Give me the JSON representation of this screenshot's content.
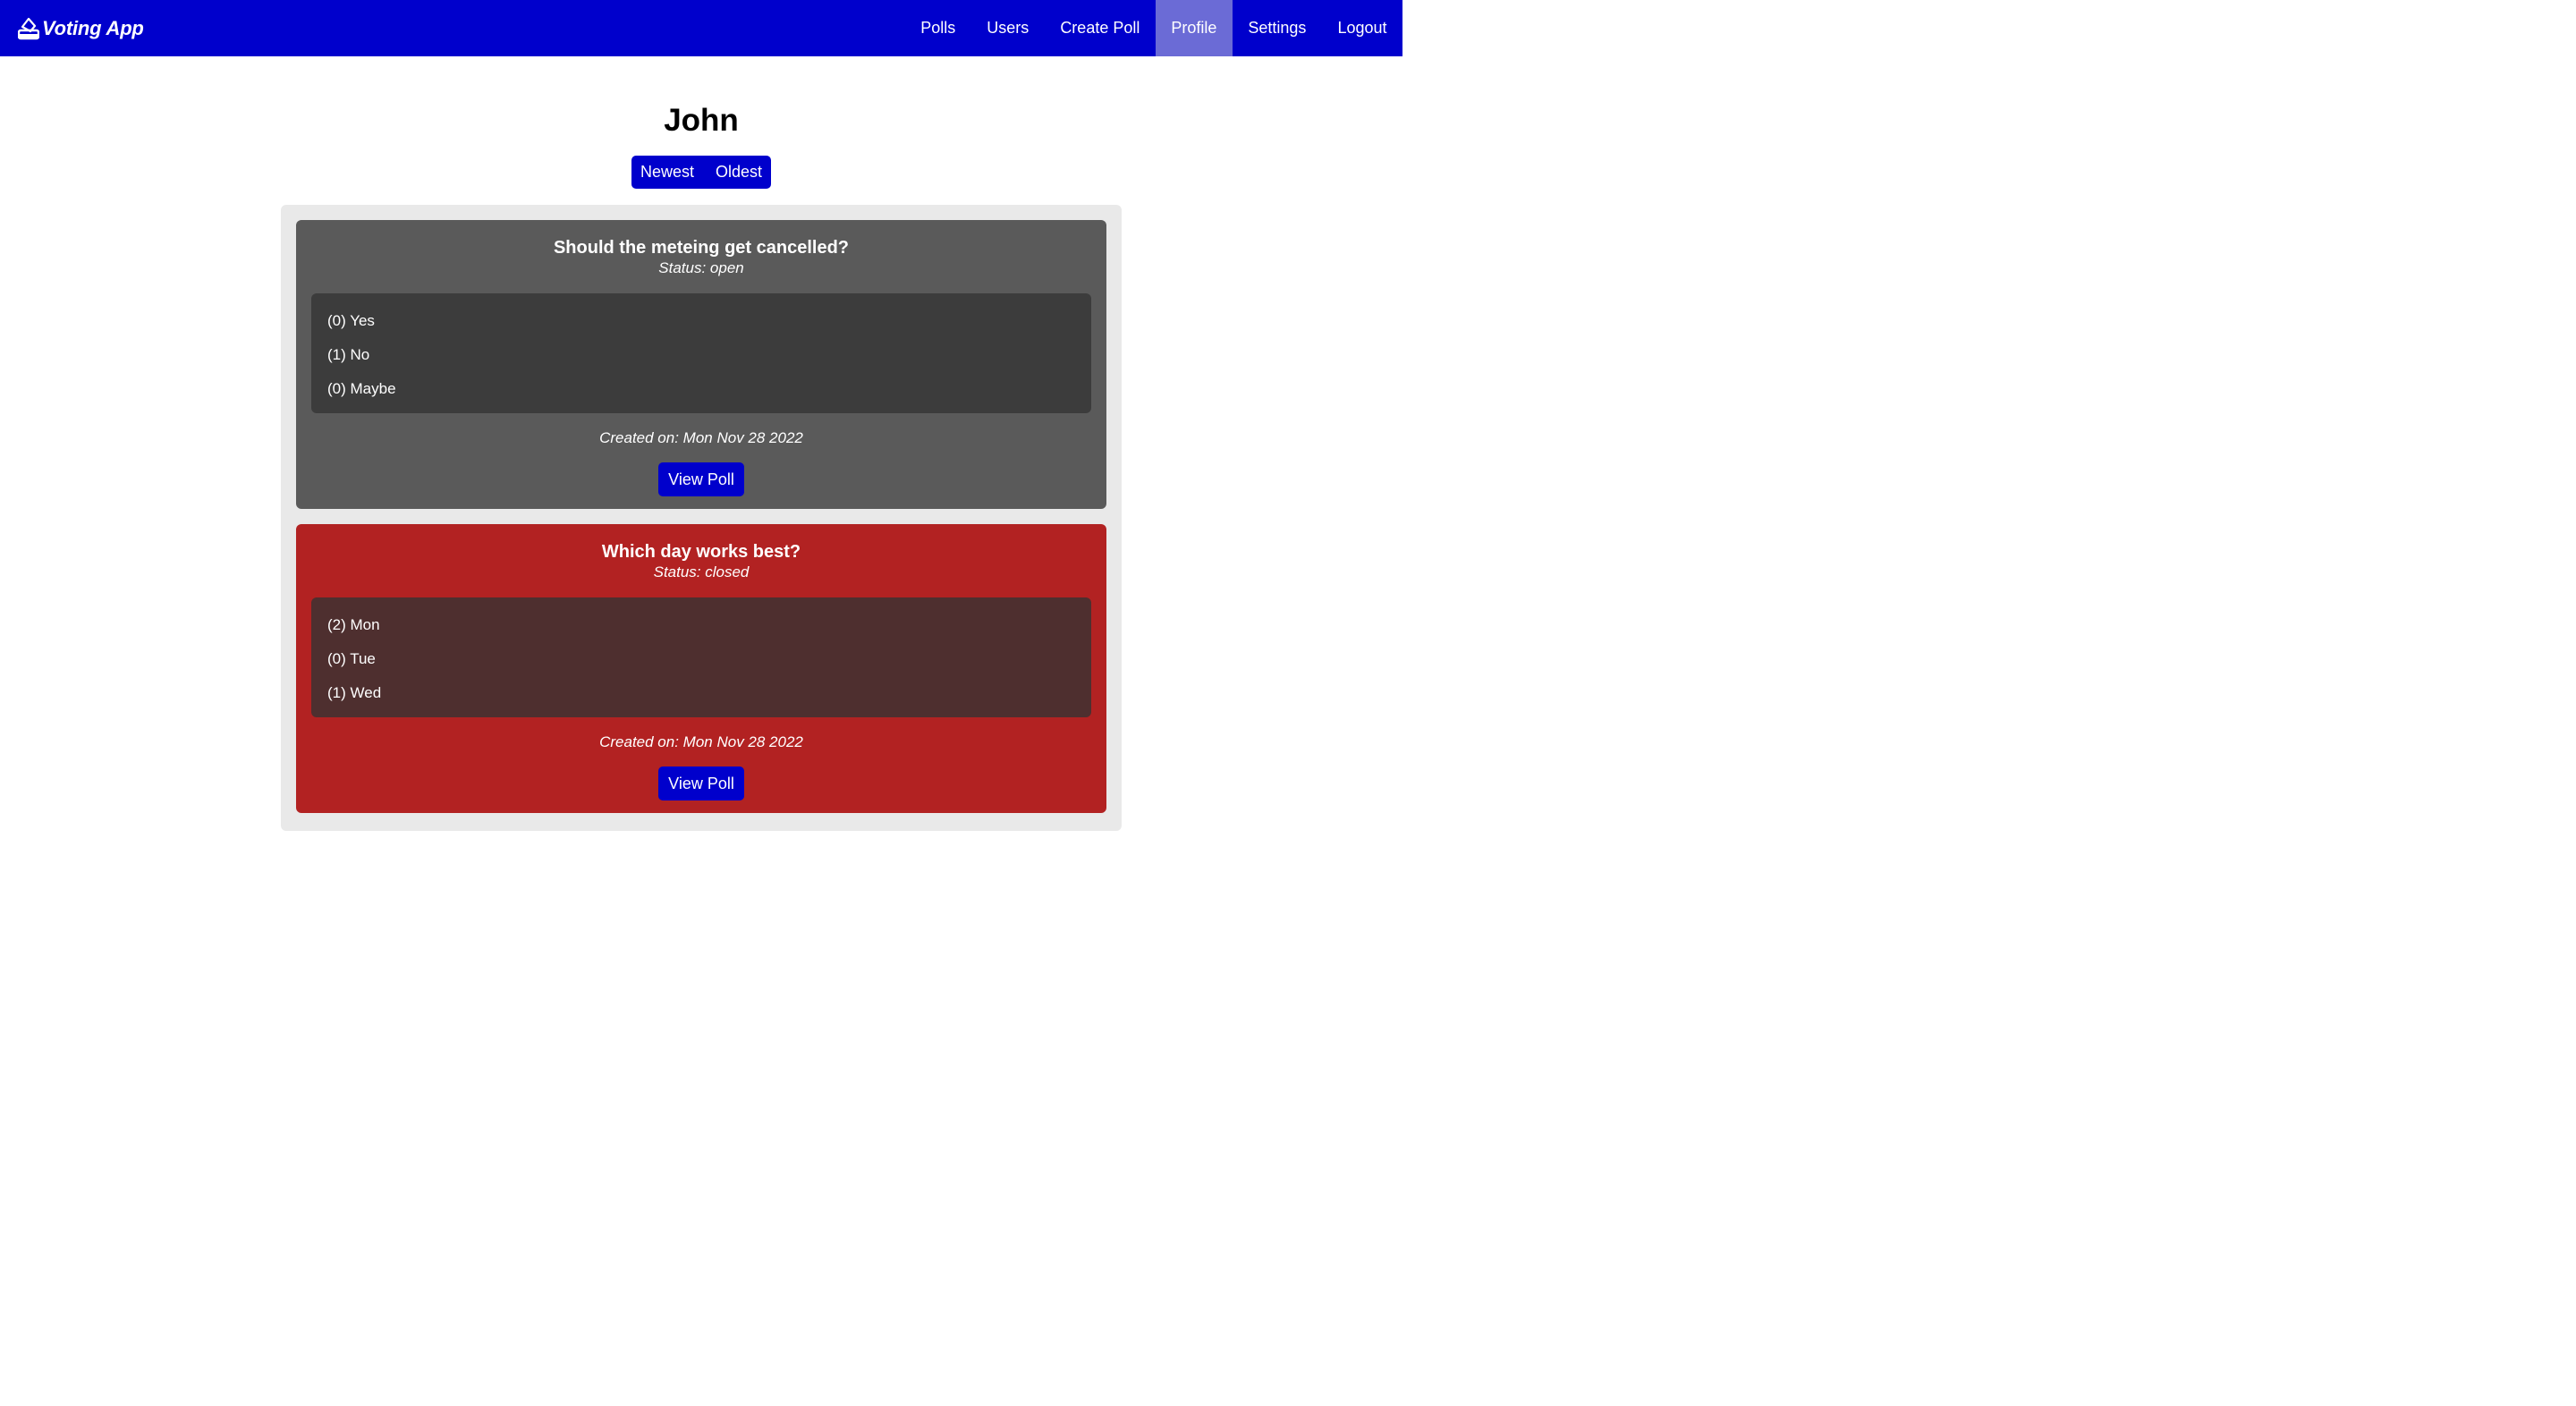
{
  "brand": {
    "name": "Voting App",
    "icon": "ballot-box-icon"
  },
  "nav": {
    "items": [
      {
        "label": "Polls"
      },
      {
        "label": "Users"
      },
      {
        "label": "Create Poll"
      },
      {
        "label": "Profile",
        "active": true
      },
      {
        "label": "Settings"
      },
      {
        "label": "Logout"
      }
    ]
  },
  "profile": {
    "name": "John",
    "sort": {
      "newest": "Newest",
      "oldest": "Oldest"
    }
  },
  "polls": [
    {
      "title": "Should the meteing get cancelled?",
      "status": "Status: open",
      "options": [
        "(0) Yes",
        "(1) No",
        "(0) Maybe"
      ],
      "created": "Created on: Mon Nov 28 2022",
      "button": "View Poll"
    },
    {
      "title": "Which day works best?",
      "status": "Status: closed",
      "options": [
        "(2) Mon",
        "(0) Tue",
        "(1) Wed"
      ],
      "created": "Created on: Mon Nov 28 2022",
      "button": "View Poll"
    }
  ],
  "colors": {
    "primary": "#0000cc",
    "nav_active": "#6b6bd6",
    "open_card": "#5a5a5a",
    "closed_card": "#b22222"
  }
}
